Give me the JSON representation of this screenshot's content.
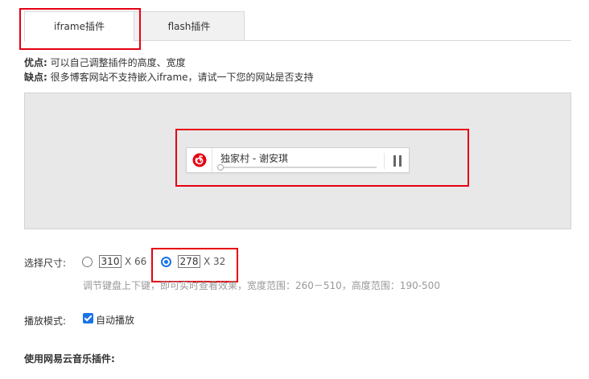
{
  "tabs": [
    {
      "label": "iframe插件",
      "active": true
    },
    {
      "label": "flash插件",
      "active": false
    }
  ],
  "info": {
    "pros_label": "优点:",
    "pros_text": "可以自己调整插件的高度、宽度",
    "cons_label": "缺点:",
    "cons_text": "很多博客网站不支持嵌入iframe，请试一下您的网站是否支持"
  },
  "player": {
    "logo_icon": "netease-music-icon",
    "title": "独家村 - 谢安琪",
    "progress": 0,
    "state": "playing",
    "pause_icon": "pause-icon"
  },
  "size": {
    "label": "选择尺寸:",
    "options": [
      {
        "width": "310",
        "height_text": "X 66",
        "checked": false
      },
      {
        "width": "278",
        "height_text": "X 32",
        "checked": true
      }
    ],
    "hint": "调节键盘上下键，即可实时查看效果，宽度范围：260－510，高度范围：190-500"
  },
  "mode": {
    "label": "播放模式:",
    "autoplay_label": "自动播放",
    "autoplay_checked": true
  },
  "usage_title": "使用网易云音乐插件:",
  "colors": {
    "highlight": "#e60012",
    "accent": "#1a73e8",
    "brand": "#e60012"
  }
}
